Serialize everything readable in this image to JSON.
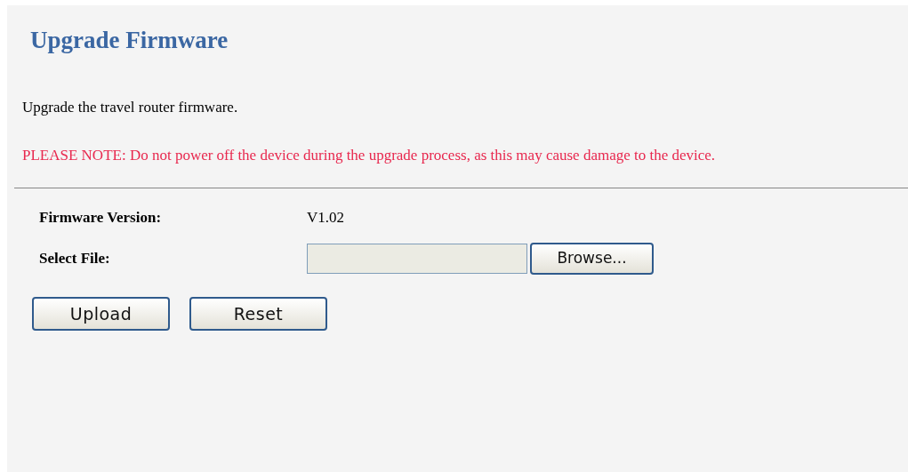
{
  "title": "Upgrade Firmware",
  "description": "Upgrade the travel router firmware.",
  "note": "PLEASE NOTE: Do not power off the device during the upgrade process, as this may cause damage to the device.",
  "fields": [
    {
      "kind": "text",
      "label": "Firmware Version:",
      "value": "V1.02"
    },
    {
      "kind": "file",
      "label": "Select File:",
      "button": "Browse..."
    }
  ],
  "buttons": [
    "Upload",
    "Reset"
  ]
}
